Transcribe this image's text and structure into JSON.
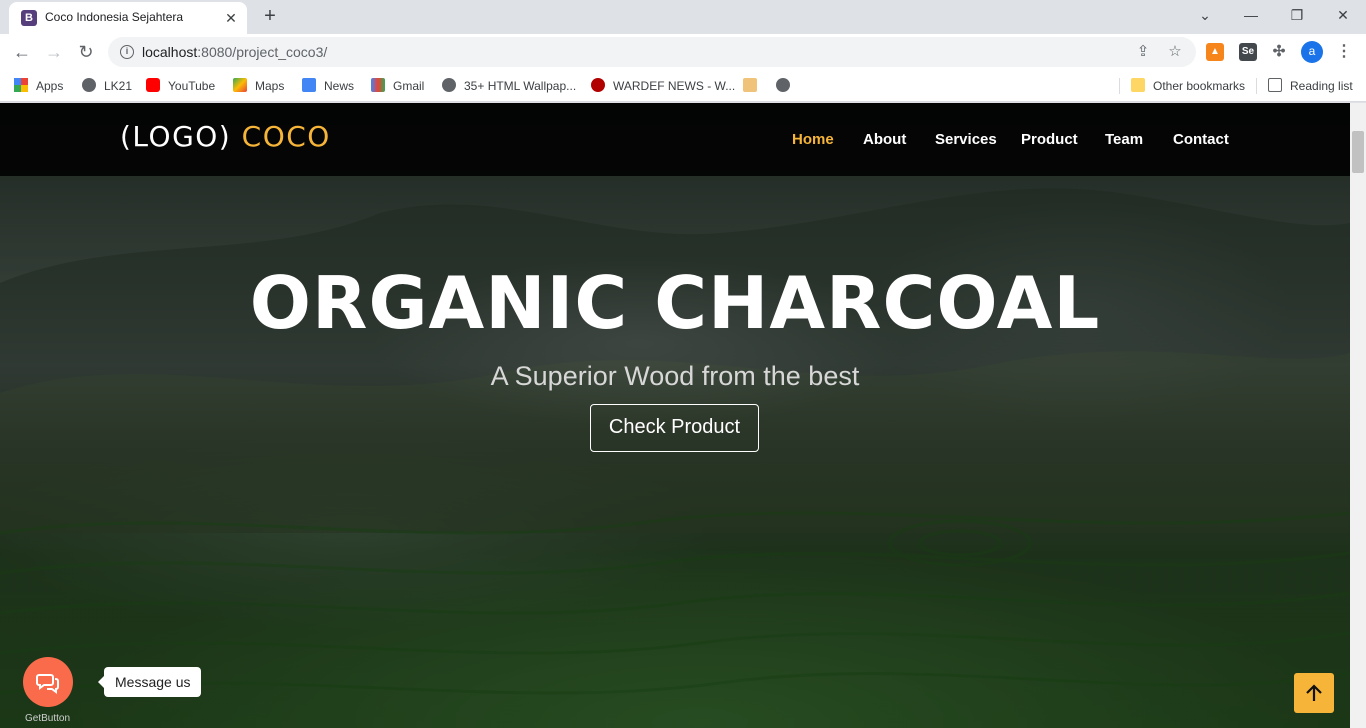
{
  "browser": {
    "tab_title": "Coco Indonesia Sejahtera",
    "tab_favicon_letter": "B",
    "url_host": "localhost",
    "url_path": ":8080/project_coco3/",
    "profile_initial": "a",
    "extensions": {
      "selenium_label": "Se"
    },
    "bookmarks": [
      {
        "label": "Apps",
        "icon": "apps-grid-icon"
      },
      {
        "label": "LK21",
        "icon": "globe-icon"
      },
      {
        "label": "YouTube",
        "icon": "youtube-icon"
      },
      {
        "label": "Maps",
        "icon": "maps-icon"
      },
      {
        "label": "News",
        "icon": "news-icon"
      },
      {
        "label": "Gmail",
        "icon": "gmail-icon"
      },
      {
        "label": "35+ HTML Wallpap...",
        "icon": "globe-icon"
      },
      {
        "label": "WARDEF NEWS - W...",
        "icon": "wardef-icon"
      }
    ],
    "other_bookmarks": "Other bookmarks",
    "reading_list": "Reading list"
  },
  "site": {
    "logo_text": "(LOGO)",
    "logo_accent": "COCO",
    "nav": [
      {
        "label": "Home",
        "active": true
      },
      {
        "label": "About",
        "active": false
      },
      {
        "label": "Services",
        "active": false
      },
      {
        "label": "Product",
        "active": false
      },
      {
        "label": "Team",
        "active": false
      },
      {
        "label": "Contact",
        "active": false
      }
    ]
  },
  "hero": {
    "title": "ORGANIC CHARCOAL",
    "subtitle": "A Superior Wood from the best",
    "button": "Check Product"
  },
  "widgets": {
    "chat_label": "Message us",
    "chat_brand": "GetButton"
  },
  "colors": {
    "accent": "#f6b539",
    "chat": "#fa6b4c",
    "header_bg": "#0b0b0b"
  }
}
